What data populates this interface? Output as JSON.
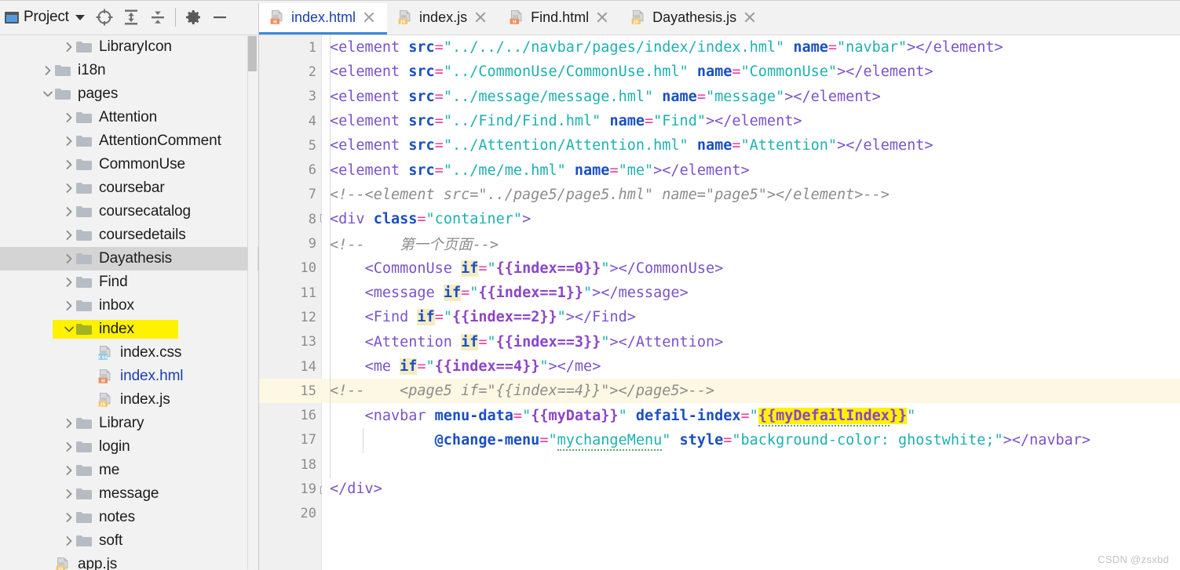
{
  "sidebar": {
    "title": "Project",
    "toolbar_icons": [
      {
        "name": "locate-icon",
        "label": "Select Opened File"
      },
      {
        "name": "expand-all-icon",
        "label": "Expand All"
      },
      {
        "name": "collapse-all-icon",
        "label": "Collapse All"
      },
      {
        "name": "gear-icon",
        "label": "Settings"
      },
      {
        "name": "minimize-icon",
        "label": "Hide"
      }
    ],
    "tree": [
      {
        "label": "LibraryIcon",
        "indent": 2,
        "type": "folder",
        "state": "collapsed",
        "selected": false,
        "highlight": false
      },
      {
        "label": "i18n",
        "indent": 1,
        "type": "folder",
        "state": "collapsed",
        "selected": false,
        "highlight": false
      },
      {
        "label": "pages",
        "indent": 1,
        "type": "folder",
        "state": "expanded",
        "selected": false,
        "highlight": false
      },
      {
        "label": "Attention",
        "indent": 2,
        "type": "folder",
        "state": "collapsed",
        "selected": false,
        "highlight": false
      },
      {
        "label": "AttentionComment",
        "indent": 2,
        "type": "folder",
        "state": "collapsed",
        "selected": false,
        "highlight": false
      },
      {
        "label": "CommonUse",
        "indent": 2,
        "type": "folder",
        "state": "collapsed",
        "selected": false,
        "highlight": false
      },
      {
        "label": "coursebar",
        "indent": 2,
        "type": "folder",
        "state": "collapsed",
        "selected": false,
        "highlight": false
      },
      {
        "label": "coursecatalog",
        "indent": 2,
        "type": "folder",
        "state": "collapsed",
        "selected": false,
        "highlight": false
      },
      {
        "label": "coursedetails",
        "indent": 2,
        "type": "folder",
        "state": "collapsed",
        "selected": false,
        "highlight": false
      },
      {
        "label": "Dayathesis",
        "indent": 2,
        "type": "folder",
        "state": "collapsed",
        "selected": true,
        "highlight": false
      },
      {
        "label": "Find",
        "indent": 2,
        "type": "folder",
        "state": "collapsed",
        "selected": false,
        "highlight": false
      },
      {
        "label": "inbox",
        "indent": 2,
        "type": "folder",
        "state": "collapsed",
        "selected": false,
        "highlight": false
      },
      {
        "label": "index",
        "indent": 2,
        "type": "folder",
        "state": "expanded",
        "selected": false,
        "highlight": true
      },
      {
        "label": "index.css",
        "indent": 3,
        "type": "css",
        "state": "none",
        "selected": false,
        "highlight": false
      },
      {
        "label": "index.hml",
        "indent": 3,
        "type": "html",
        "state": "none",
        "selected": false,
        "highlight": false,
        "blue": true
      },
      {
        "label": "index.js",
        "indent": 3,
        "type": "js",
        "state": "none",
        "selected": false,
        "highlight": false
      },
      {
        "label": "Library",
        "indent": 2,
        "type": "folder",
        "state": "collapsed",
        "selected": false,
        "highlight": false
      },
      {
        "label": "login",
        "indent": 2,
        "type": "folder",
        "state": "collapsed",
        "selected": false,
        "highlight": false
      },
      {
        "label": "me",
        "indent": 2,
        "type": "folder",
        "state": "collapsed",
        "selected": false,
        "highlight": false
      },
      {
        "label": "message",
        "indent": 2,
        "type": "folder",
        "state": "collapsed",
        "selected": false,
        "highlight": false
      },
      {
        "label": "notes",
        "indent": 2,
        "type": "folder",
        "state": "collapsed",
        "selected": false,
        "highlight": false
      },
      {
        "label": "soft",
        "indent": 2,
        "type": "folder",
        "state": "collapsed",
        "selected": false,
        "highlight": false
      },
      {
        "label": "app.js",
        "indent": 1,
        "type": "js",
        "state": "none",
        "selected": false,
        "highlight": false
      }
    ]
  },
  "tabs": [
    {
      "label": "index.html",
      "type": "html",
      "active": true
    },
    {
      "label": "index.js",
      "type": "js",
      "active": false
    },
    {
      "label": "Find.html",
      "type": "html",
      "active": false
    },
    {
      "label": "Dayathesis.js",
      "type": "js",
      "active": false
    }
  ],
  "editor": {
    "line_numbers": [
      "1",
      "2",
      "3",
      "4",
      "5",
      "6",
      "7",
      "8",
      "9",
      "10",
      "11",
      "12",
      "13",
      "14",
      "15",
      "16",
      "17",
      "18",
      "19",
      "20"
    ],
    "current_line": 15,
    "lines": [
      {
        "n": 1,
        "text": "<element src=\"../../../navbar/pages/index/index.hml\" name=\"navbar\"></element>"
      },
      {
        "n": 2,
        "text": "<element src=\"../CommonUse/CommonUse.hml\" name=\"CommonUse\"></element>"
      },
      {
        "n": 3,
        "text": "<element src=\"../message/message.hml\" name=\"message\"></element>"
      },
      {
        "n": 4,
        "text": "<element src=\"../Find/Find.hml\" name=\"Find\"></element>"
      },
      {
        "n": 5,
        "text": "<element src=\"../Attention/Attention.hml\" name=\"Attention\"></element>"
      },
      {
        "n": 6,
        "text": "<element src=\"../me/me.hml\" name=\"me\"></element>"
      },
      {
        "n": 7,
        "text": "<!--<element src=\"../page5/page5.hml\" name=\"page5\"></element>-->"
      },
      {
        "n": 8,
        "text": "<div class=\"container\">"
      },
      {
        "n": 9,
        "text": "<!--    第一个页面-->"
      },
      {
        "n": 10,
        "text": "    <CommonUse if=\"{{index==0}}\"></CommonUse>"
      },
      {
        "n": 11,
        "text": "    <message if=\"{{index==1}}\"></message>"
      },
      {
        "n": 12,
        "text": "    <Find if=\"{{index==2}}\"></Find>"
      },
      {
        "n": 13,
        "text": "    <Attention if=\"{{index==3}}\"></Attention>"
      },
      {
        "n": 14,
        "text": "    <me if=\"{{index==4}}\"></me>"
      },
      {
        "n": 15,
        "text": "<!--    <page5 if=\"{{index==4}}\"></page5>-->"
      },
      {
        "n": 16,
        "text": "    <navbar menu-data=\"{{myData}}\" defail-index=\"{{myDefailIndex}}\""
      },
      {
        "n": 17,
        "text": "            @change-menu=\"mychangeMenu\" style=\"background-color: ghostwhite;\"></navbar>"
      },
      {
        "n": 18,
        "text": ""
      },
      {
        "n": 19,
        "text": "</div>"
      },
      {
        "n": 20,
        "text": ""
      }
    ],
    "highlighted_tokens": [
      "if",
      "{{myDefailIndex}}"
    ],
    "warning_tokens": [
      "mychangeMenu",
      "myDefailIndex"
    ]
  },
  "watermark": "CSDN @zsxbd",
  "colors": {
    "accent": "#3c8ad9",
    "tag": "#7a52cc",
    "attribute": "#1a4fc4",
    "equals": "#ec3ba0",
    "string": "#1fb0b0",
    "comment": "#8c8c8c",
    "expression": "#8b45c9",
    "selection": "#d4d4d4",
    "marker_yellow": "#fff200",
    "caret_line": "#fdf8e3"
  }
}
